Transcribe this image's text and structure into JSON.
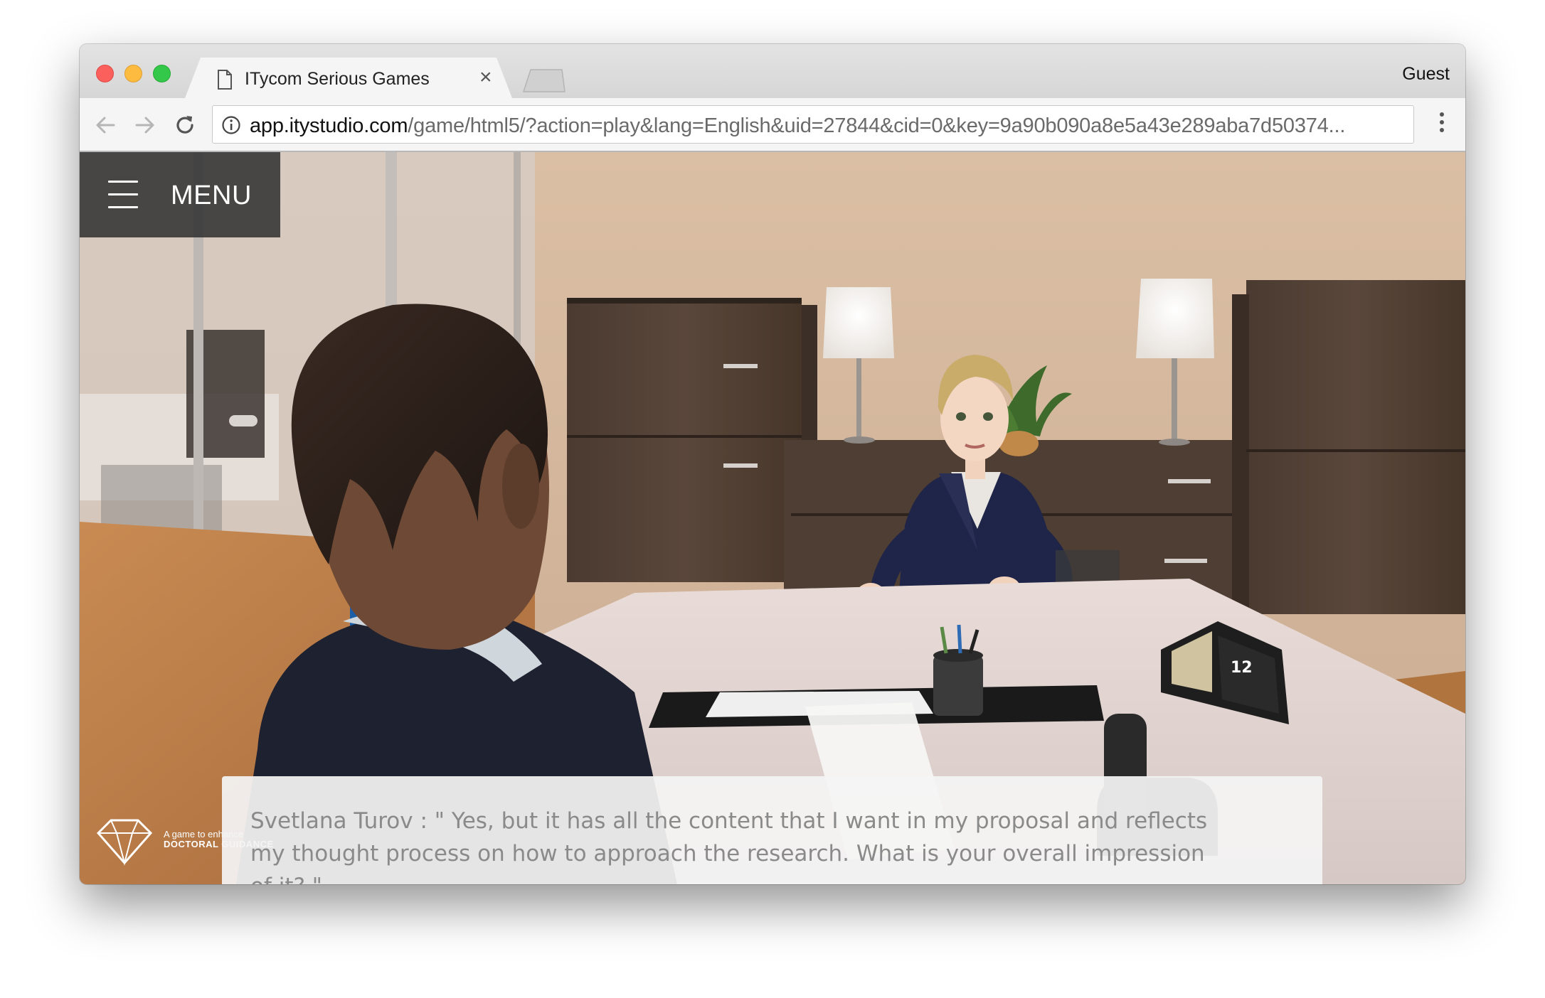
{
  "browser": {
    "tab": {
      "title": "ITycom Serious Games",
      "close_glyph": "×",
      "icon": "document-icon"
    },
    "profile_label": "Guest",
    "address_bar": {
      "host": "app.itystudio.com",
      "path": "/game/html5/?action=play&lang=English&uid=27844&cid=0&key=9a90b090a8e5a43e289aba7d50374..."
    }
  },
  "game": {
    "menu_label": "MENU",
    "dialog": {
      "text": "Svetlana Turov : \" Yes, but it has all the content that I want in my proposal and reflects my thought process on how to approach the research. What is your overall impression of it? \""
    },
    "logo": {
      "tagline": "A game to enhance",
      "title": "DOCTORAL GUIDANCE"
    }
  },
  "colors": {
    "traffic_red": "#fc605c",
    "traffic_yellow": "#fdbc40",
    "traffic_green": "#34c84a",
    "menu_bg": "#303030",
    "dialog_bg": "#f4f4f4",
    "dialog_text": "#8a8a8a"
  }
}
